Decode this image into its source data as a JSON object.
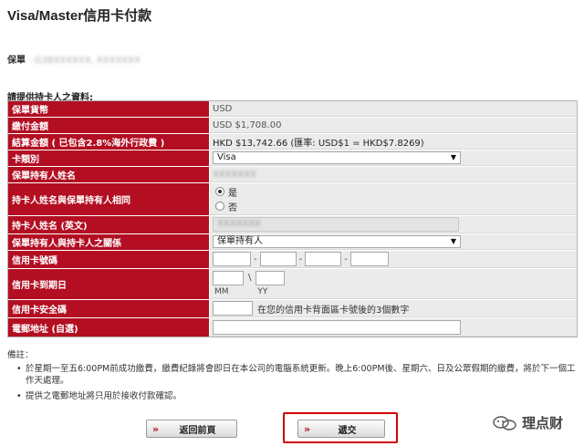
{
  "page_title": "Visa/Master信用卡付款",
  "policy": {
    "label": "保單",
    "value": " - G38XXXXXX, XXXXXXX"
  },
  "section_heading": "請提供持卡人之資料:",
  "rows": {
    "currency": {
      "label": "保單貨幣",
      "value": "USD"
    },
    "amount": {
      "label": "繳付金額",
      "value": "USD $1,708.00"
    },
    "settle": {
      "label": "結算金額 ( 已包含2.8%海外行政費 )",
      "value": "HKD $13,742.66 (匯率: USD$1 = HKD$7.8269)"
    },
    "card_type": {
      "label": "卡類別",
      "selected": "Visa"
    },
    "holder_name": {
      "label": "保單持有人姓名",
      "value": "XXXXXXX"
    },
    "same_name": {
      "label": "持卡人姓名與保單持有人相同",
      "options": [
        "是",
        "否"
      ],
      "selected": "是"
    },
    "card_name": {
      "label": "持卡人姓名 (英文)",
      "value": "XXXXXXX"
    },
    "relation": {
      "label": "保單持有人與持卡人之關係",
      "selected": "保單持有人"
    },
    "card_number": {
      "label": "信用卡號碼",
      "separator": "-"
    },
    "expiry": {
      "label": "信用卡到期日",
      "separator": "\\",
      "mm_label": "MM",
      "yy_label": "YY"
    },
    "cvv": {
      "label": "信用卡安全碼",
      "hint": "在您的信用卡背面區卡號後的3個數字"
    },
    "email": {
      "label": "電郵地址 (自選)"
    }
  },
  "notes": {
    "title": "備註：",
    "items": [
      "於星期一至五6:00PM前成功繳費，繳費紀錄將會即日在本公司的電腦系統更新。晚上6:00PM後、星期六、日及公眾假期的繳費，將於下一個工作天處理。",
      "提供之電郵地址將只用於接收付款確認。"
    ]
  },
  "buttons": {
    "back": "返回前頁",
    "submit": "遞交",
    "chevron": "»"
  },
  "watermark": "理点财",
  "colors": {
    "label_bg": "#b30e22",
    "value_bg": "#ebebeb",
    "highlight": "#d40000"
  }
}
